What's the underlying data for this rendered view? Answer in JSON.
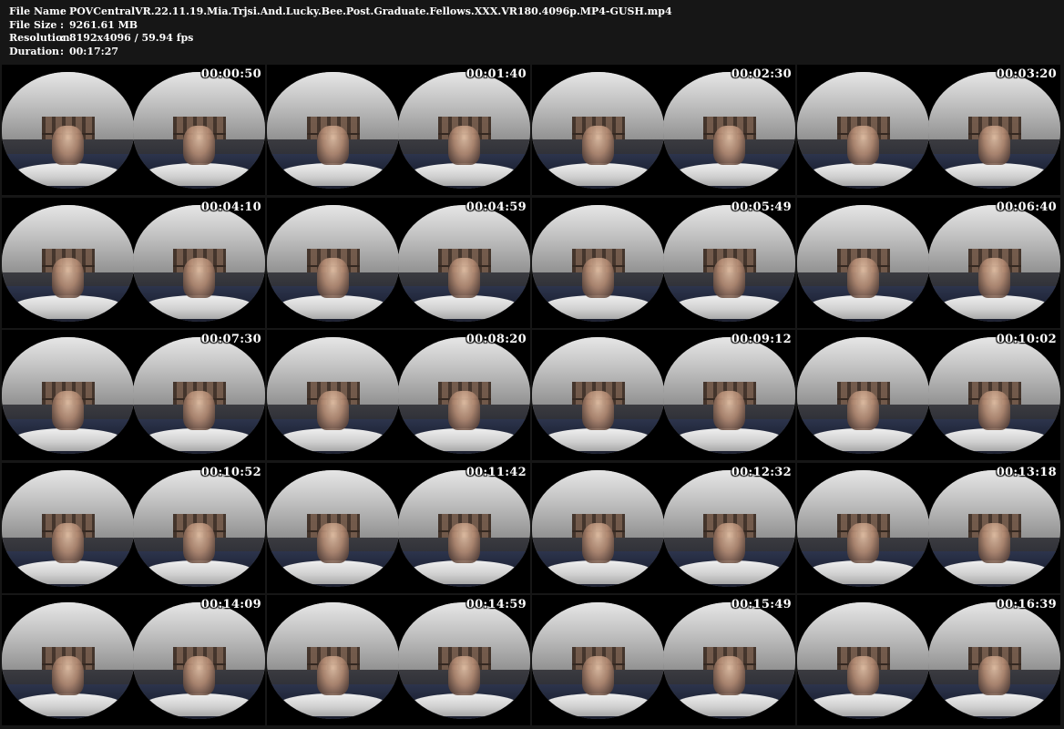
{
  "info": {
    "file_name_label": "File Name",
    "file_name_value": "POVCentralVR.22.11.19.Mia.Trjsi.And.Lucky.Bee.Post.Graduate.Fellows.XXX.VR180.4096p.MP4-GUSH.mp4",
    "file_size_label": "File Size",
    "file_size_value": "9261.61 MB",
    "resolution_label": "Resolution",
    "resolution_value": "8192x4096 / 59.94 fps",
    "duration_label": "Duration",
    "duration_value": "00:17:27",
    "separator": ":"
  },
  "thumbnails": [
    {
      "time": "00:00:50"
    },
    {
      "time": "00:01:40"
    },
    {
      "time": "00:02:30"
    },
    {
      "time": "00:03:20"
    },
    {
      "time": "00:04:10"
    },
    {
      "time": "00:04:59"
    },
    {
      "time": "00:05:49"
    },
    {
      "time": "00:06:40"
    },
    {
      "time": "00:07:30"
    },
    {
      "time": "00:08:20"
    },
    {
      "time": "00:09:12"
    },
    {
      "time": "00:10:02"
    },
    {
      "time": "00:10:52"
    },
    {
      "time": "00:11:42"
    },
    {
      "time": "00:12:32"
    },
    {
      "time": "00:13:18"
    },
    {
      "time": "00:14:09"
    },
    {
      "time": "00:14:59"
    },
    {
      "time": "00:15:49"
    },
    {
      "time": "00:16:39"
    }
  ]
}
